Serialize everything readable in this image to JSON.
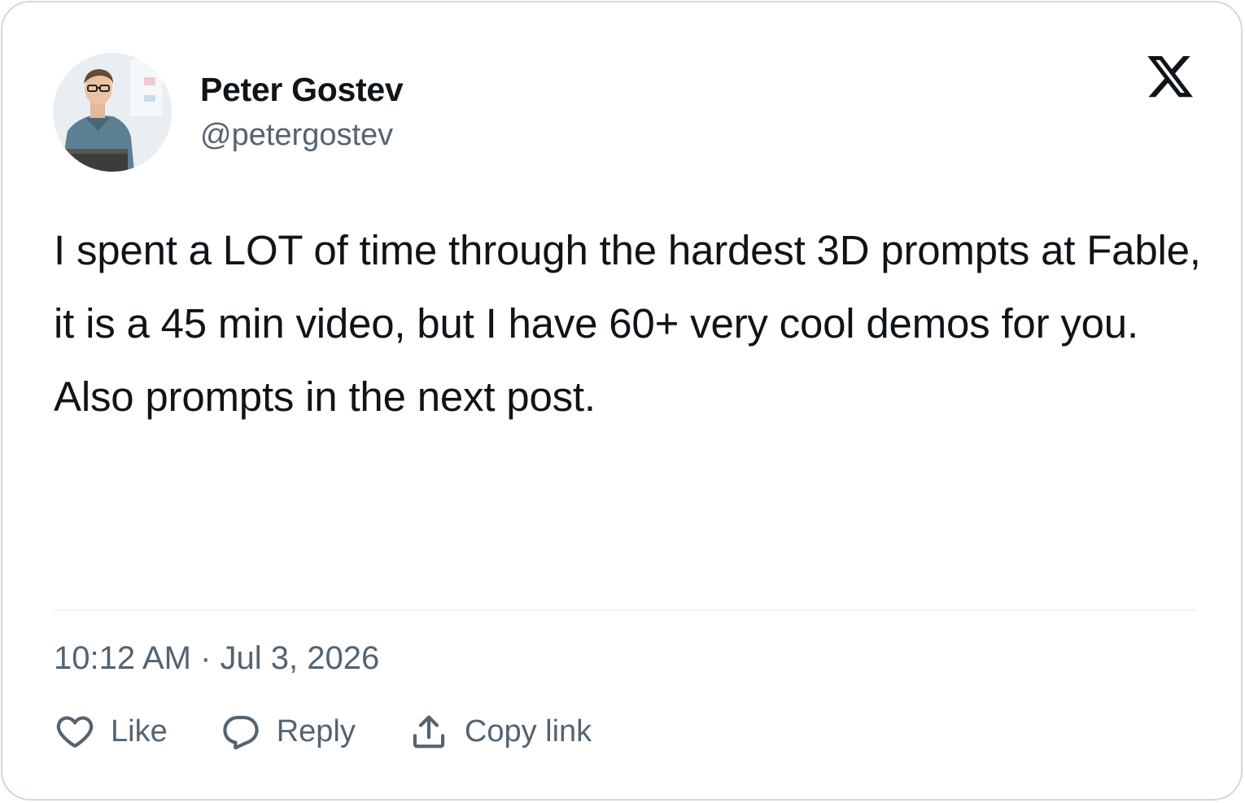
{
  "author": {
    "display_name": "Peter Gostev",
    "handle": "@petergostev",
    "avatar": "person-photo-avatar"
  },
  "brand": {
    "logo": "x-logo-icon",
    "color": "#0f1419"
  },
  "tweet": {
    "text": "I spent a LOT of time through the hardest 3D prompts at Fable, it is a 45 min video, but I have 60+ very cool demos for you. Also prompts in the next post.",
    "timestamp": "10:12 AM · Jul 3, 2026"
  },
  "actions": {
    "like_label": "Like",
    "like_icon": "heart-icon",
    "reply_label": "Reply",
    "reply_icon": "speech-bubble-icon",
    "copy_label": "Copy link",
    "copy_icon": "upload-share-icon"
  },
  "colors": {
    "text_primary": "#0f1419",
    "text_secondary": "#536471",
    "border": "#cfd9de"
  }
}
